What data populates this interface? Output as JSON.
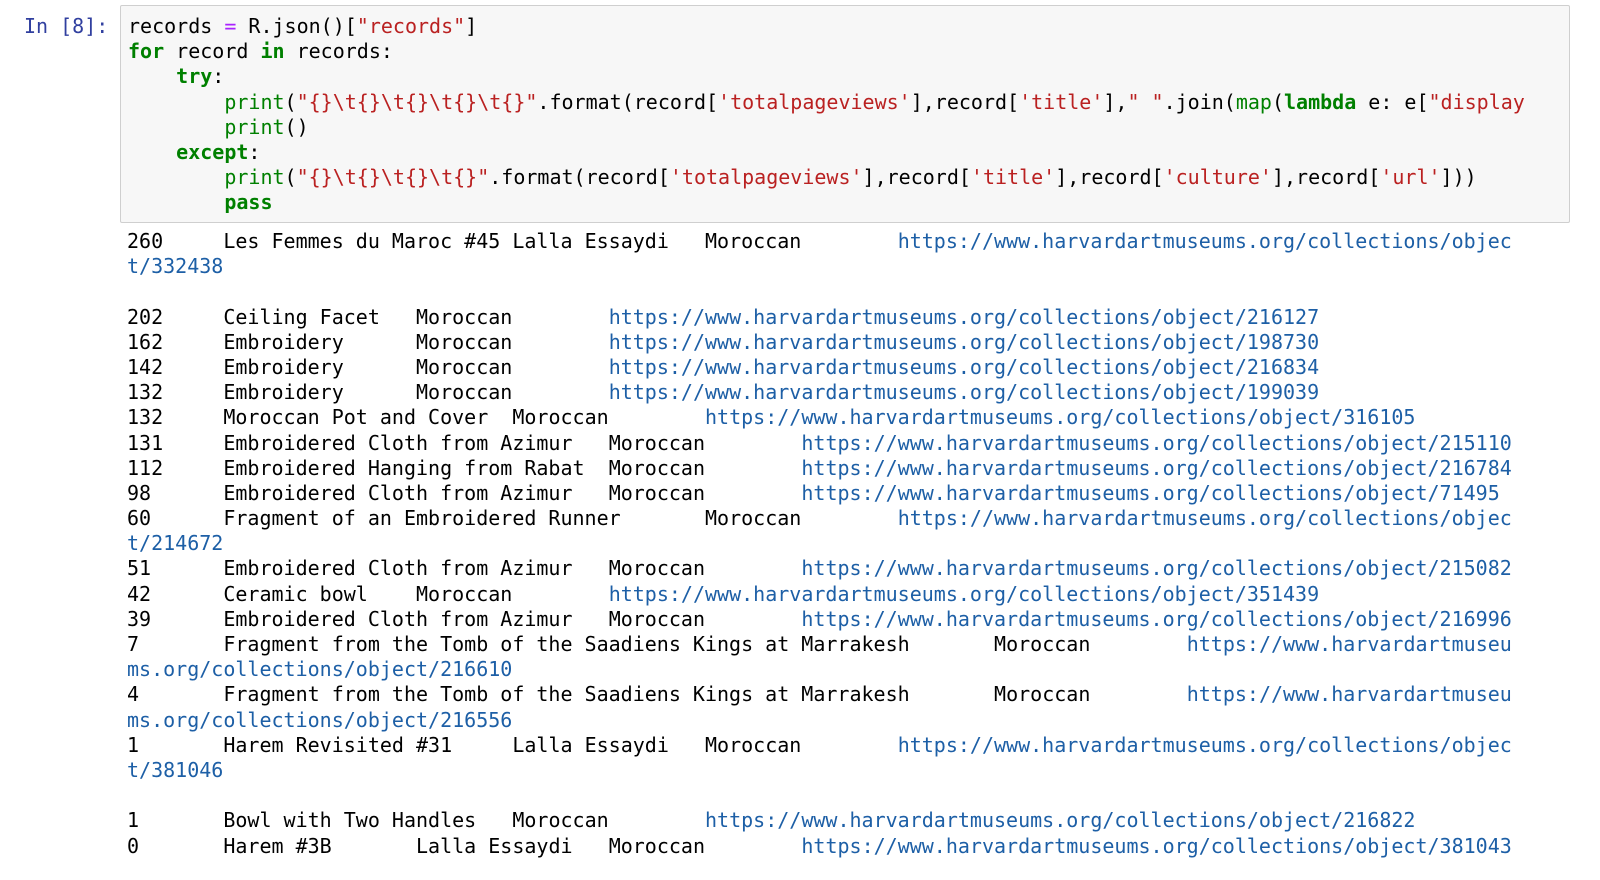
{
  "prompt": "In [8]:",
  "code": {
    "l1": {
      "a": "records ",
      "op": "=",
      "b": " R.json()[",
      "s": "\"records\"",
      "c": "]"
    },
    "l2": {
      "k1": "for",
      "a": " record ",
      "k2": "in",
      "b": " records:"
    },
    "l3": {
      "indent": "    ",
      "k": "try",
      "a": ":"
    },
    "l4": {
      "indent": "        ",
      "f": "print",
      "p1": "(",
      "s1": "\"{}\\t{}\\t{}\\t{}\\t{}\"",
      "a": ".format(record[",
      "s2": "'totalpageviews'",
      "b": "],record[",
      "s3": "'title'",
      "c": "],",
      "s4": "\" \"",
      "d": ".join(",
      "f2": "map",
      "e": "(",
      "k": "lambda",
      "g": " e: e[",
      "s5": "\"display"
    },
    "l5": {
      "indent": "        ",
      "f": "print",
      "a": "()"
    },
    "l6": {
      "indent": "    ",
      "k": "except",
      "a": ":"
    },
    "l7": {
      "indent": "        ",
      "f": "print",
      "p1": "(",
      "s1": "\"{}\\t{}\\t{}\\t{}\"",
      "a": ".format(record[",
      "s2": "'totalpageviews'",
      "b": "],record[",
      "s3": "'title'",
      "c": "],record[",
      "s4": "'culture'",
      "d": "],record[",
      "s5": "'url'",
      "e": "]))"
    },
    "l8": {
      "indent": "        ",
      "k": "pass"
    }
  },
  "output": [
    {
      "views": "260",
      "title": "Les Femmes du Maroc #45",
      "artist": "Lalla Essaydi",
      "culture": "Moroccan",
      "url": "https://www.harvardartmuseums.org/collections/objec",
      "url_cont": "t/332438",
      "blank_after": true
    },
    {
      "views": "202",
      "title": "Ceiling Facet",
      "culture": "Moroccan",
      "url": "https://www.harvardartmuseums.org/collections/object/216127"
    },
    {
      "views": "162",
      "title": "Embroidery",
      "culture": "Moroccan",
      "url": "https://www.harvardartmuseums.org/collections/object/198730"
    },
    {
      "views": "142",
      "title": "Embroidery",
      "culture": "Moroccan",
      "url": "https://www.harvardartmuseums.org/collections/object/216834"
    },
    {
      "views": "132",
      "title": "Embroidery",
      "culture": "Moroccan",
      "url": "https://www.harvardartmuseums.org/collections/object/199039"
    },
    {
      "views": "132",
      "title": "Moroccan Pot and Cover",
      "culture": "Moroccan",
      "url": "https://www.harvardartmuseums.org/collections/object/316105"
    },
    {
      "views": "131",
      "title": "Embroidered Cloth from Azimur",
      "culture": "Moroccan",
      "url": "https://www.harvardartmuseums.org/collections/object/215110"
    },
    {
      "views": "112",
      "title": "Embroidered Hanging from Rabat",
      "culture": "Moroccan",
      "url": "https://www.harvardartmuseums.org/collections/object/216784"
    },
    {
      "views": "98",
      "title": "Embroidered Cloth from Azimur",
      "culture": "Moroccan",
      "url": "https://www.harvardartmuseums.org/collections/object/71495"
    },
    {
      "views": "60",
      "title": "Fragment of an Embroidered Runner",
      "culture": "Moroccan",
      "url": "https://www.harvardartmuseums.org/collections/objec",
      "url_cont": "t/214672"
    },
    {
      "views": "51",
      "title": "Embroidered Cloth from Azimur",
      "culture": "Moroccan",
      "url": "https://www.harvardartmuseums.org/collections/object/215082"
    },
    {
      "views": "42",
      "title": "Ceramic bowl",
      "culture": "Moroccan",
      "url": "https://www.harvardartmuseums.org/collections/object/351439"
    },
    {
      "views": "39",
      "title": "Embroidered Cloth from Azimur",
      "culture": "Moroccan",
      "url": "https://www.harvardartmuseums.org/collections/object/216996"
    },
    {
      "views": "7",
      "title": "Fragment from the Tomb of the Saadiens Kings at Marrakesh",
      "culture": "Moroccan",
      "url": "https://www.harvardartmuseu",
      "url_cont": "ms.org/collections/object/216610"
    },
    {
      "views": "4",
      "title": "Fragment from the Tomb of the Saadiens Kings at Marrakesh",
      "culture": "Moroccan",
      "url": "https://www.harvardartmuseu",
      "url_cont": "ms.org/collections/object/216556"
    },
    {
      "views": "1",
      "title": "Harem Revisited #31",
      "artist": "Lalla Essaydi",
      "culture": "Moroccan",
      "url": "https://www.harvardartmuseums.org/collections/objec",
      "url_cont": "t/381046",
      "blank_after": true
    },
    {
      "views": "1",
      "title": "Bowl with Two Handles",
      "culture": "Moroccan",
      "url": "https://www.harvardartmuseums.org/collections/object/216822"
    },
    {
      "views": "0",
      "title": "Harem #3B",
      "artist": "Lalla Essaydi",
      "culture": "Moroccan",
      "url": "https://www.harvardartmuseums.org/collections/object/381043"
    }
  ]
}
